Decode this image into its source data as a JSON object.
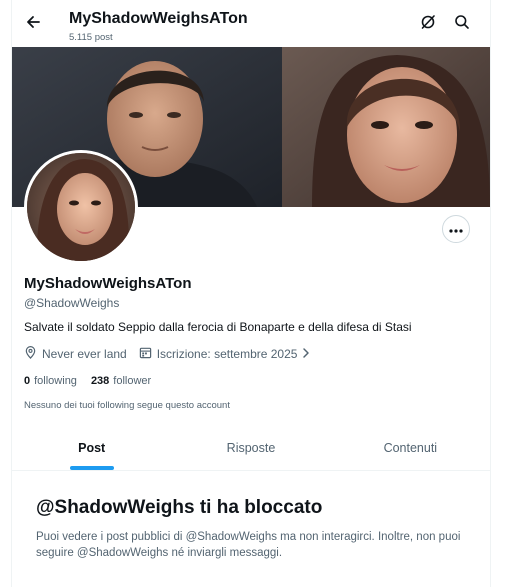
{
  "header": {
    "back_icon": "arrow-left-icon",
    "title": "MyShadowWeighsATon",
    "post_count": "5.115 post",
    "grok_icon": "grok-icon",
    "search_icon": "search-icon"
  },
  "profile": {
    "display_name": "MyShadowWeighsATon",
    "handle": "@ShadowWeighs",
    "bio": "Salvate il soldato Seppio dalla ferocia di Bonaparte e della difesa di Stasi",
    "location": "Never ever land",
    "joined": "Iscrizione: settembre 2025",
    "following_count": "0",
    "following_label": "following",
    "followers_count": "238",
    "followers_label": "follower",
    "followers_note": "Nessuno dei tuoi following segue questo account"
  },
  "tabs": [
    {
      "label": "Post",
      "active": true
    },
    {
      "label": "Risposte",
      "active": false
    },
    {
      "label": "Contenuti",
      "active": false
    }
  ],
  "blocked": {
    "title": "@ShadowWeighs ti ha bloccato",
    "description": "Puoi vedere i post pubblici di @ShadowWeighs ma non interagirci. Inoltre, non puoi seguire @ShadowWeighs né inviargli messaggi."
  },
  "colors": {
    "accent": "#1d9bf0",
    "text_primary": "#0f1419",
    "text_secondary": "#536471",
    "border": "#eff3f4"
  }
}
